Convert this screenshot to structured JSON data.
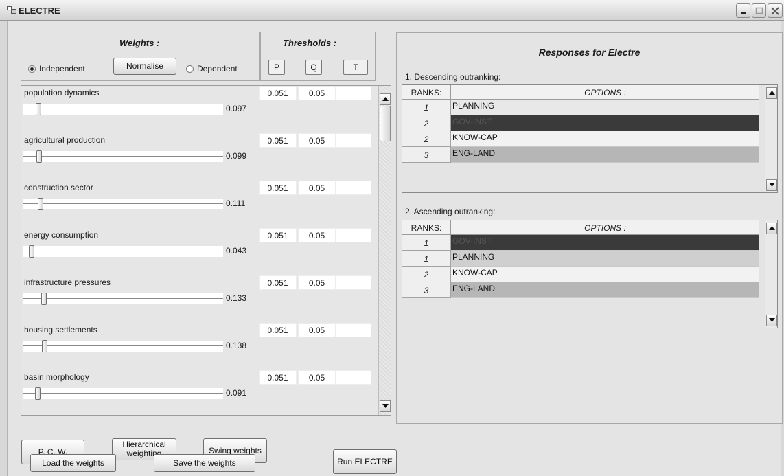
{
  "window": {
    "title": "ELECTRE"
  },
  "weights": {
    "header": "Weights :",
    "radio_independent": "Independent",
    "radio_dependent": "Dependent",
    "normalise_label": "Normalise",
    "selected": "Independent"
  },
  "thresholds": {
    "header": "Thresholds :",
    "p": "P",
    "q": "Q",
    "t": "T"
  },
  "criteria": [
    {
      "name": "population dynamics",
      "value": "0.097",
      "p": "0.051",
      "q": "0.05",
      "t": ""
    },
    {
      "name": "agricultural production",
      "value": "0.099",
      "p": "0.051",
      "q": "0.05",
      "t": ""
    },
    {
      "name": "construction sector",
      "value": "0.111",
      "p": "0.051",
      "q": "0.05",
      "t": ""
    },
    {
      "name": "energy consumption",
      "value": "0.043",
      "p": "0.051",
      "q": "0.05",
      "t": ""
    },
    {
      "name": "infrastructure pressures",
      "value": "0.133",
      "p": "0.051",
      "q": "0.05",
      "t": ""
    },
    {
      "name": "housing settlements",
      "value": "0.138",
      "p": "0.051",
      "q": "0.05",
      "t": ""
    },
    {
      "name": "basin morphology",
      "value": "0.091",
      "p": "0.051",
      "q": "0.05",
      "t": ""
    }
  ],
  "buttons": {
    "pcw": "P. C. W.",
    "hier_line1": "Hierarchical",
    "hier_line2": "weighting",
    "swing": "Swing weights",
    "load": "Load the weights",
    "save": "Save the weights",
    "run": "Run ELECTRE"
  },
  "responses": {
    "title": "Responses for Electre",
    "descending": {
      "label": "1. Descending outranking:",
      "col_ranks": "RANKS:",
      "col_options": "OPTIONS :",
      "rows": [
        {
          "rank": "1",
          "option": "PLANNING",
          "shade": "#e8e8e8"
        },
        {
          "rank": "2",
          "option": "GOV-INST",
          "shade": "#3a3a3a"
        },
        {
          "rank": "2",
          "option": "KNOW-CAP",
          "shade": "#f2f2f2"
        },
        {
          "rank": "3",
          "option": "ENG-LAND",
          "shade": "#b6b6b6"
        }
      ]
    },
    "ascending": {
      "label": "2. Ascending outranking:",
      "col_ranks": "RANKS:",
      "col_options": "OPTIONS :",
      "rows": [
        {
          "rank": "1",
          "option": "GOV-INST",
          "shade": "#3a3a3a"
        },
        {
          "rank": "1",
          "option": "PLANNING",
          "shade": "#cfcfcf"
        },
        {
          "rank": "2",
          "option": "KNOW-CAP",
          "shade": "#f2f2f2"
        },
        {
          "rank": "3",
          "option": "ENG-LAND",
          "shade": "#b6b6b6"
        }
      ]
    }
  }
}
